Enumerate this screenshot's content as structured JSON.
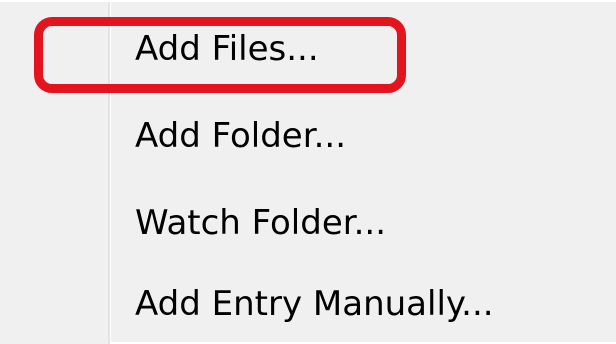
{
  "menu": {
    "items": [
      {
        "label": "Add Files..."
      },
      {
        "label": "Add Folder..."
      },
      {
        "label": "Watch Folder..."
      },
      {
        "label": "Add Entry Manually..."
      }
    ],
    "highlight_color": "#e3141e",
    "background_color": "#f0f0f0"
  }
}
